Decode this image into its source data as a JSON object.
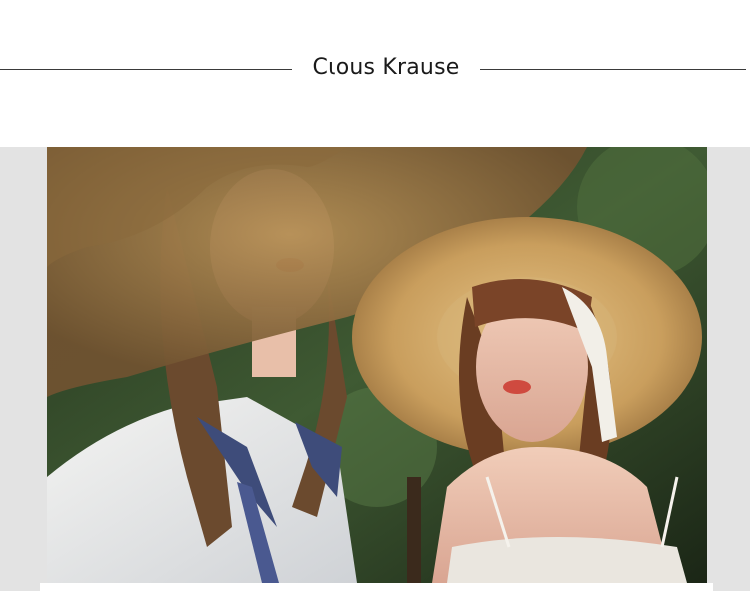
{
  "header": {
    "brand_title": "Cιous Krause"
  },
  "hero": {
    "image_icon": "photo-of-two-models-in-straw-hats"
  },
  "colors": {
    "background": "#ffffff",
    "band": "#e3e3e3",
    "rule": "#3a3a3a",
    "title": "#1a1a1a"
  }
}
